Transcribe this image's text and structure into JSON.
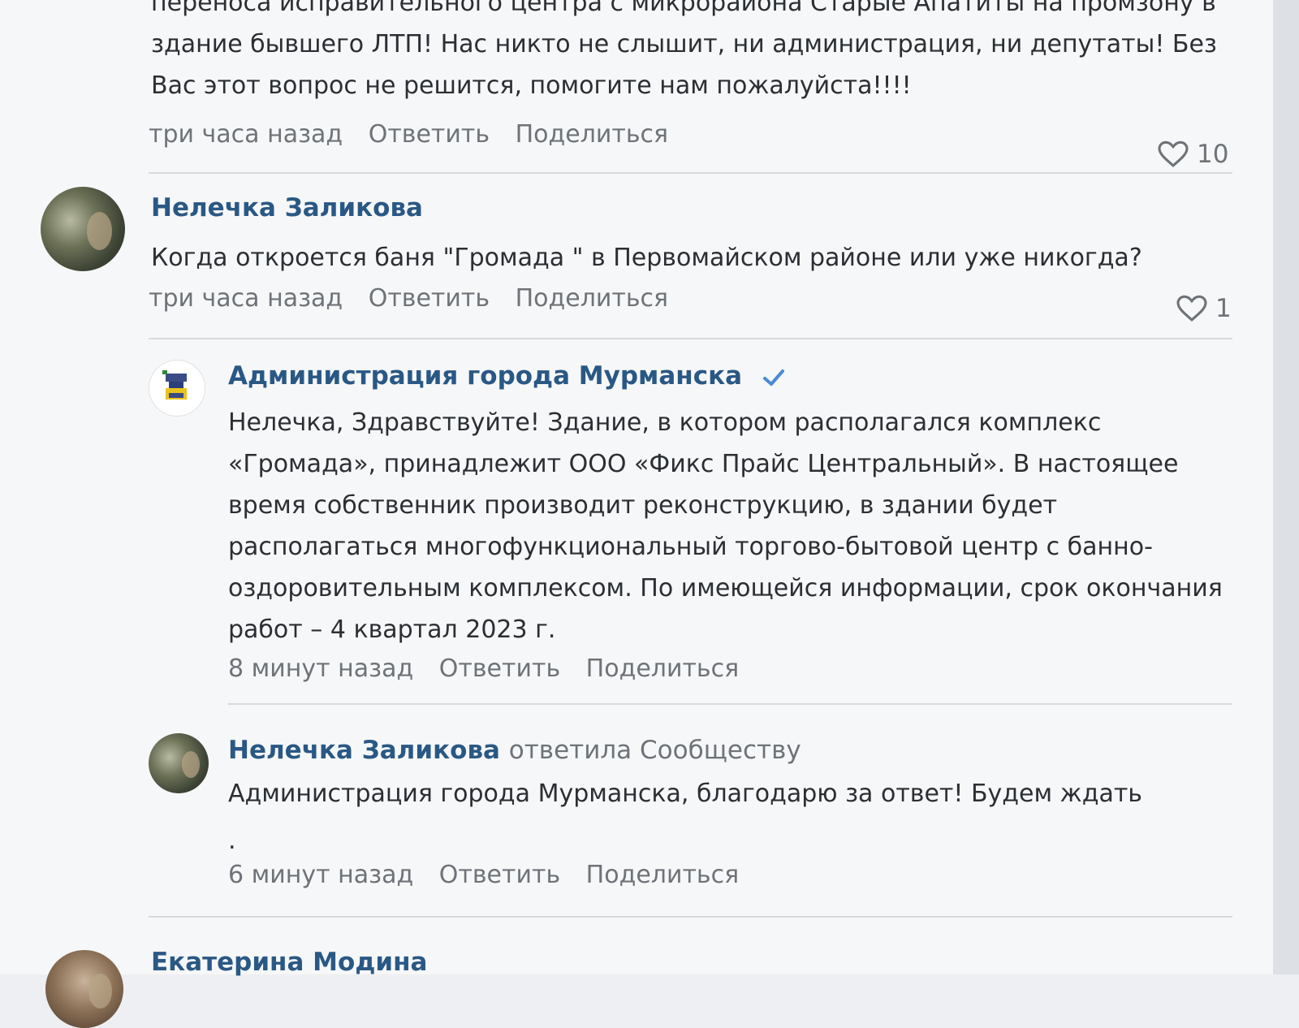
{
  "comments": [
    {
      "text": "переноса исправительного центра с микрорайона Старые Апатиты на промзону в здание бывшего ЛТП! Нас никто не слышит, ни администрация, ни депутаты! Без Вас этот вопрос не решится, помогите нам пожалуйста!!!!",
      "time": "три часа назад",
      "reply": "Ответить",
      "share": "Поделиться",
      "likes": "10"
    },
    {
      "author": "Нелечка Заликова",
      "text": "Когда откроется баня \"Громада \" в Первомайском районе или уже никогда?",
      "time": "три часа назад",
      "reply": "Ответить",
      "share": "Поделиться",
      "likes": "1"
    },
    {
      "author": "Администрация города Мурманска",
      "verified_icon": "checkmark-icon",
      "text": "Нелечка, Здравствуйте! Здание, в котором располагался комплекс «Громада», принадлежит ООО «Фикс Прайс Центральный». В настоящее время собственник производит реконструкцию, в здании будет располагаться многофункциональный торгово-бытовой центр с банно-оздоровительным комплексом. По имеющейся информации, срок окончания работ – 4 квартал 2023 г.",
      "time": "8 минут назад",
      "reply": "Ответить",
      "share": "Поделиться"
    },
    {
      "author": "Нелечка Заликова",
      "replied_to": "ответила Сообществу",
      "text": "Администрация города Мурманска, благодарю за ответ! Будем ждать",
      "text_tail": ".",
      "time": "6 минут назад",
      "reply": "Ответить",
      "share": "Поделиться"
    },
    {
      "author": "Екатерина Модина"
    }
  ],
  "colors": {
    "author_link": "#2a5885",
    "meta_gray": "#6e7378",
    "verified": "#4a8bd6",
    "background": "#f6f7f8"
  }
}
